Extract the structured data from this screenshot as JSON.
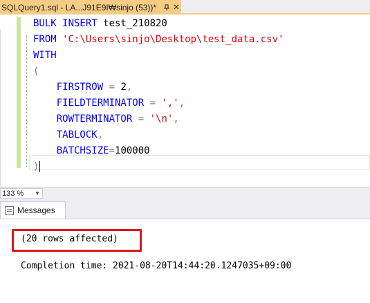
{
  "tab": {
    "title": "SQLQuery1.sql - LA...J91E9I₩sinjo (53))*",
    "pin_icon": "pin-icon",
    "close_icon": "close-icon"
  },
  "editor": {
    "lines": {
      "l1_kw": "BULK INSERT",
      "l1_name": " test_210820",
      "l2_kw": "FROM",
      "l2_str": "'C:\\Users\\sinjo\\Desktop\\test_data.csv'",
      "l3_kw": "WITH",
      "l4_paren": "(",
      "l5_key": "FIRSTROW",
      "l5_eq": " = ",
      "l5_val": "2",
      "l5_comma": ",",
      "l6_key": "FIELDTERMINATOR",
      "l6_eq": " = ",
      "l6_val": "','",
      "l6_comma": ",",
      "l7_key": "ROWTERMINATOR",
      "l7_eq": " = ",
      "l7_val": "'\\n'",
      "l7_comma": ",",
      "l8_key": "TABLOCK",
      "l8_comma": ",",
      "l9_key": "BATCHSIZE",
      "l9_eq": "=",
      "l9_val": "100000",
      "l10_paren": ")"
    }
  },
  "zoom": {
    "level": "133 %"
  },
  "results": {
    "tab_label": "Messages",
    "rows_affected": "(20 rows affected)",
    "completion": "Completion time: 2021-08-20T14:44:20.1247035+09:00"
  },
  "colors": {
    "keyword": "#0000ff",
    "string": "#e00000",
    "operator": "#808080",
    "tab_active": "#f5cc84",
    "highlight_border": "#e0151c"
  }
}
